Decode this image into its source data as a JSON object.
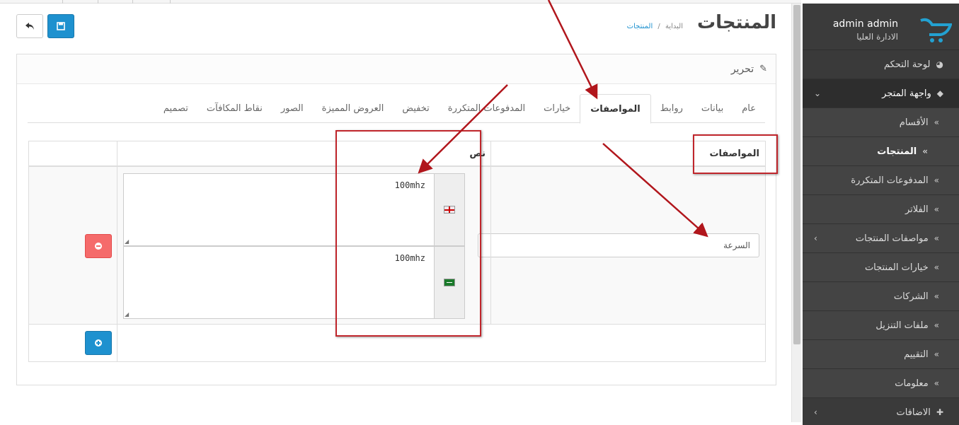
{
  "window": {
    "scroll_thumb_present": true
  },
  "sidebar": {
    "user_name": "admin admin",
    "user_role": "الادارة العليا",
    "items": [
      {
        "label": "لوحة التحكم",
        "icon": "dashboard-icon"
      },
      {
        "label": "واجهة المتجر",
        "icon": "tags-icon",
        "open": true
      },
      {
        "label": "الأقسام"
      },
      {
        "label": "المنتجات",
        "active": true
      },
      {
        "label": "المدفوعات المتكررة"
      },
      {
        "label": "الفلاتر"
      },
      {
        "label": "مواصفات المنتجات",
        "has_children": true
      },
      {
        "label": "خيارات المنتجات"
      },
      {
        "label": "الشركات"
      },
      {
        "label": "ملفات التنزيل"
      },
      {
        "label": "التقييم"
      },
      {
        "label": "معلومات"
      },
      {
        "label": "الاضافات",
        "icon": "puzzle-icon",
        "has_children": true
      }
    ]
  },
  "header": {
    "title": "المنتجات",
    "breadcrumb_home": "البداية",
    "breadcrumb_sep": "/",
    "breadcrumb_current": "المنتجات"
  },
  "panel": {
    "title": "تحرير"
  },
  "tabs": [
    {
      "label": "عام"
    },
    {
      "label": "بيانات"
    },
    {
      "label": "روابط"
    },
    {
      "label": "المواصفات",
      "active": true
    },
    {
      "label": "خيارات"
    },
    {
      "label": "المدفوعات المتكررة"
    },
    {
      "label": "تخفيض"
    },
    {
      "label": "العروض المميزة"
    },
    {
      "label": "الصور"
    },
    {
      "label": "نقاط المكافآت"
    },
    {
      "label": "تصميم"
    }
  ],
  "attributes_table": {
    "col_attribute": "المواصفات",
    "col_text": "نص",
    "rows": [
      {
        "attribute": "السرعة",
        "texts": [
          {
            "lang": "en",
            "value": "100mhz"
          },
          {
            "lang": "ar",
            "value": "100mhz"
          }
        ]
      }
    ]
  }
}
